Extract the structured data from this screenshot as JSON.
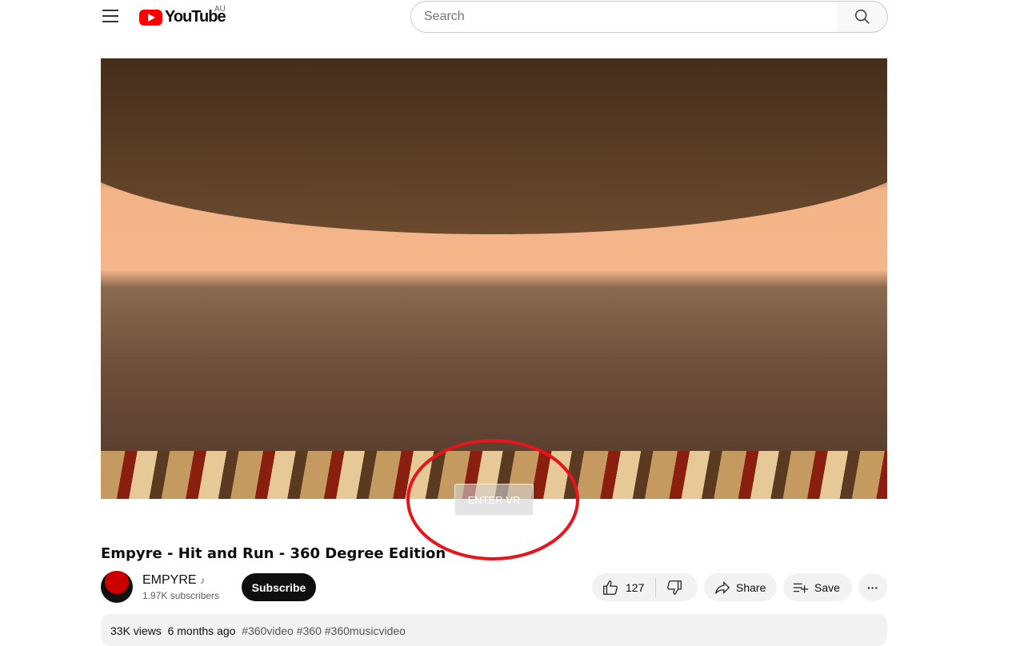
{
  "header": {
    "logo_text": "YouTube",
    "region": "AU",
    "search_placeholder": "Search"
  },
  "video": {
    "enter_vr_label": "ENTER VR",
    "title": "Empyre - Hit and Run - 360 Degree Edition"
  },
  "channel": {
    "name": "EMPYRE",
    "subscribers": "1.97K subscribers",
    "subscribe_label": "Subscribe"
  },
  "actions": {
    "likes": "127",
    "share_label": "Share",
    "save_label": "Save"
  },
  "description": {
    "views": "33K views",
    "date": "6 months ago",
    "tags": "#360video #360 #360musicvideo"
  },
  "annotation": {
    "color": "#e8141b"
  }
}
